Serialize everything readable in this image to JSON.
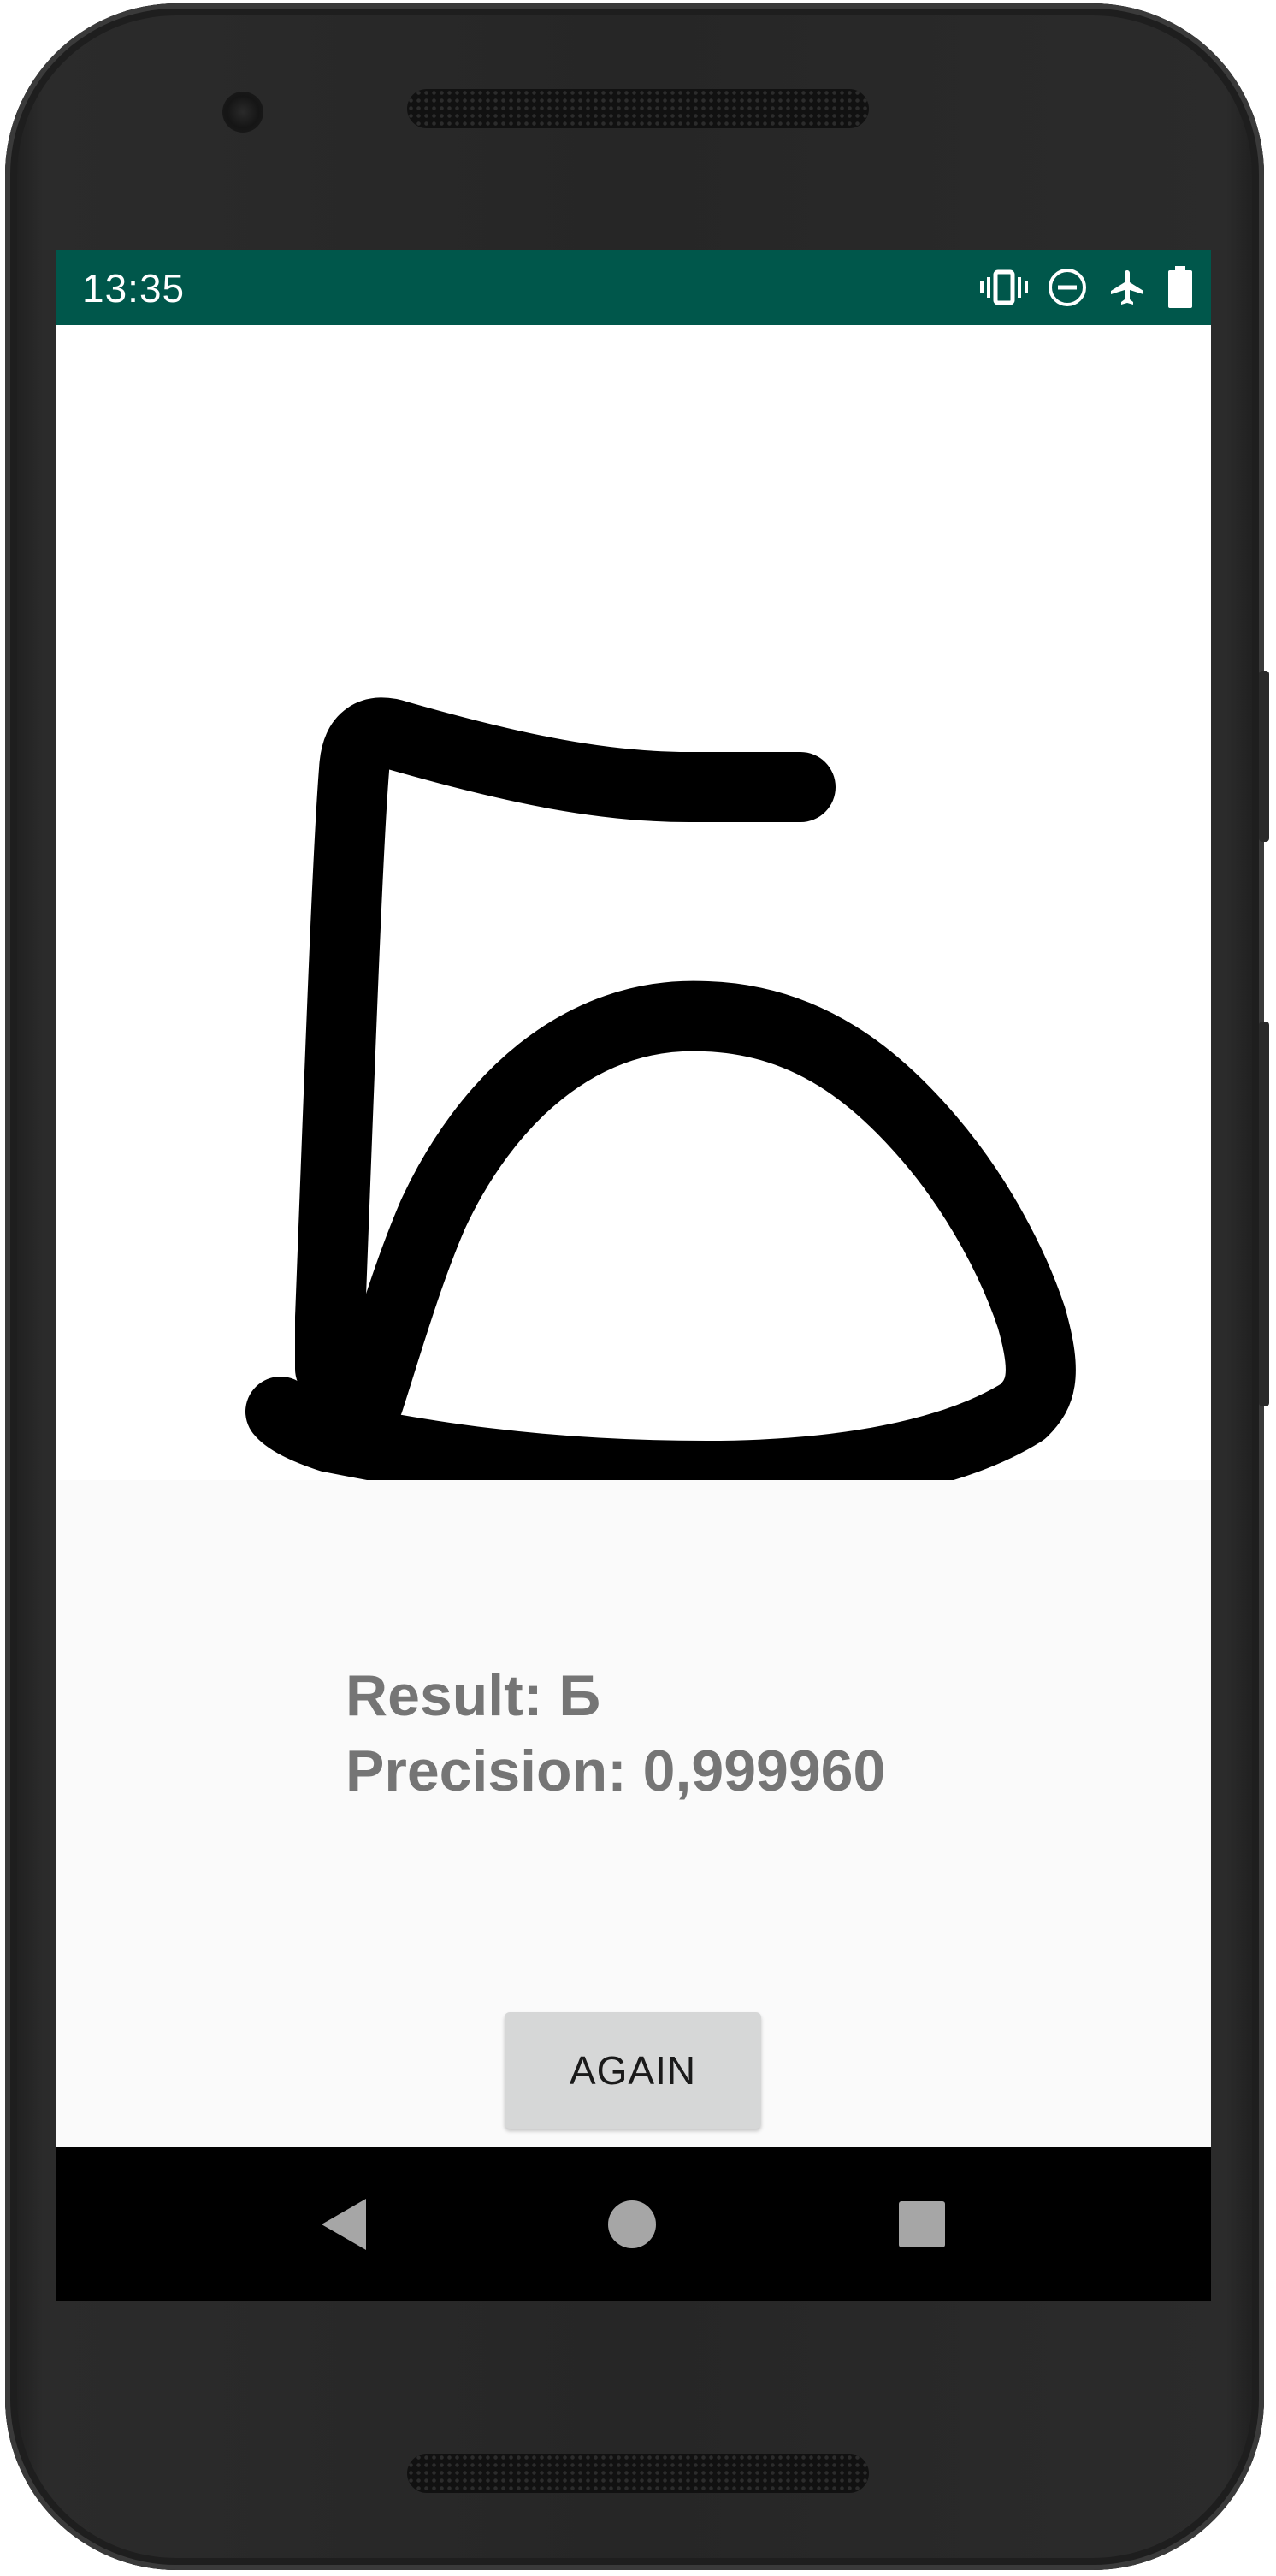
{
  "status_bar": {
    "time": "13:35",
    "background_color": "#00574b",
    "icons": [
      "vibrate-icon",
      "do-not-disturb-icon",
      "airplane-mode-icon",
      "battery-icon"
    ]
  },
  "drawing": {
    "description_icon": "handwritten-stroke",
    "stroke_color": "#000000"
  },
  "result": {
    "result_line": "Result: Б",
    "precision_line": "Precision: 0,999960",
    "text_color": "#757575"
  },
  "actions": {
    "again_label": "AGAIN"
  },
  "navigation": {
    "buttons": [
      "back-icon",
      "home-icon",
      "recents-icon"
    ]
  }
}
